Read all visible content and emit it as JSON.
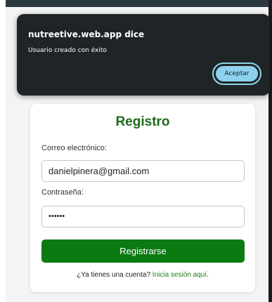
{
  "dialog": {
    "title": "nutreetive.web.app dice",
    "message": "Usuario creado con éxito",
    "accept_label": "Aceptar"
  },
  "form": {
    "title": "Registro",
    "email_label": "Correo electrónico:",
    "email_value": "danielpinera@gmail.com",
    "password_label": "Contraseña:",
    "password_value": "••••••",
    "submit_label": "Registrarse",
    "login_prompt": "¿Ya tienes una cuenta?",
    "login_link": "Inicia sesión aquí",
    "login_suffix": "."
  },
  "colors": {
    "dialog_bg": "#1f2427",
    "accept_button": "#8ed1ec",
    "title_green": "#1e6a1e",
    "button_green": "#0b7a10",
    "link_green": "#1e7d1e"
  }
}
